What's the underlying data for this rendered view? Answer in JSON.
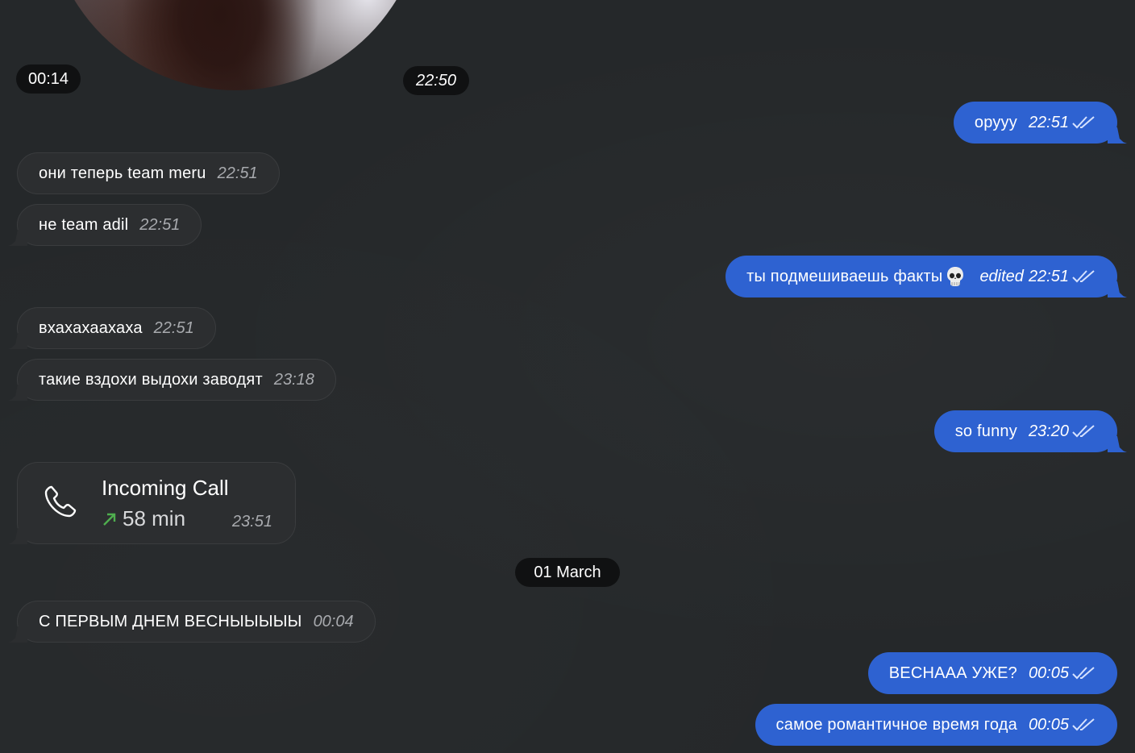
{
  "video_message": {
    "duration": "00:14",
    "time": "22:50"
  },
  "messages": [
    {
      "id": "m1",
      "direction": "out",
      "text": "орууу",
      "time": "22:51"
    },
    {
      "id": "m2",
      "direction": "in",
      "text": "они теперь team meru",
      "time": "22:51"
    },
    {
      "id": "m3",
      "direction": "in",
      "text": "не team adil",
      "time": "22:51"
    },
    {
      "id": "m4",
      "direction": "out",
      "text": "ты подмешиваешь факты",
      "emoji": "skull-icon",
      "edited": "edited",
      "time": "22:51"
    },
    {
      "id": "m5",
      "direction": "in",
      "text": "вхахахаахаха",
      "time": "22:51"
    },
    {
      "id": "m6",
      "direction": "in",
      "text": "такие вздохи выдохи заводят",
      "time": "23:18"
    },
    {
      "id": "m7",
      "direction": "out",
      "text": "so funny",
      "time": "23:20"
    },
    {
      "id": "m8",
      "direction": "in",
      "text": "С ПЕРВЫМ ДНЕМ ВЕСНЫЫЫЫЫ",
      "time": "00:04"
    },
    {
      "id": "m9",
      "direction": "out",
      "text": "ВЕСНААА УЖЕ?",
      "time": "00:05"
    },
    {
      "id": "m10",
      "direction": "out",
      "text": "самое романтичное время года",
      "time": "00:05"
    }
  ],
  "call": {
    "title": "Incoming Call",
    "duration": "58 min",
    "time": "23:51",
    "icon": "phone-icon",
    "arrow_icon": "outgoing-arrow-icon"
  },
  "date_separator": "01 March",
  "colors": {
    "background": "#25282a",
    "incoming_bubble": "#2c2e30",
    "outgoing_bubble": "#2e62d1",
    "timestamp_in": "#a8aaae",
    "call_arrow": "#4fae4e"
  }
}
